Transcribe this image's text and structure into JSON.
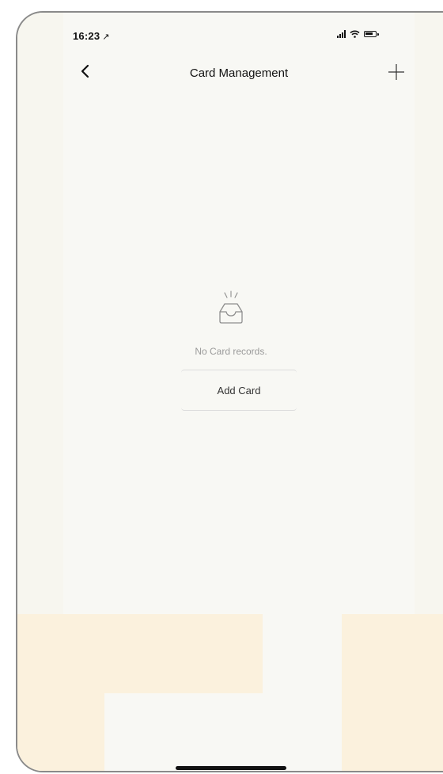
{
  "status_bar": {
    "time": "16:23",
    "location_glyph": "↗",
    "icons": [
      "signal-icon",
      "wifi-icon",
      "battery-icon"
    ]
  },
  "nav": {
    "title": "Card Management",
    "back_icon": "chevron-left-icon",
    "add_icon": "plus-icon"
  },
  "empty_state": {
    "icon": "empty-inbox-icon",
    "message": "No Card records.",
    "button_label": "Add Card"
  },
  "colors": {
    "background": "#f8f8f4",
    "text_primary": "#111111",
    "text_muted": "#9a9a9a",
    "watermark": "#fbf1dd"
  }
}
